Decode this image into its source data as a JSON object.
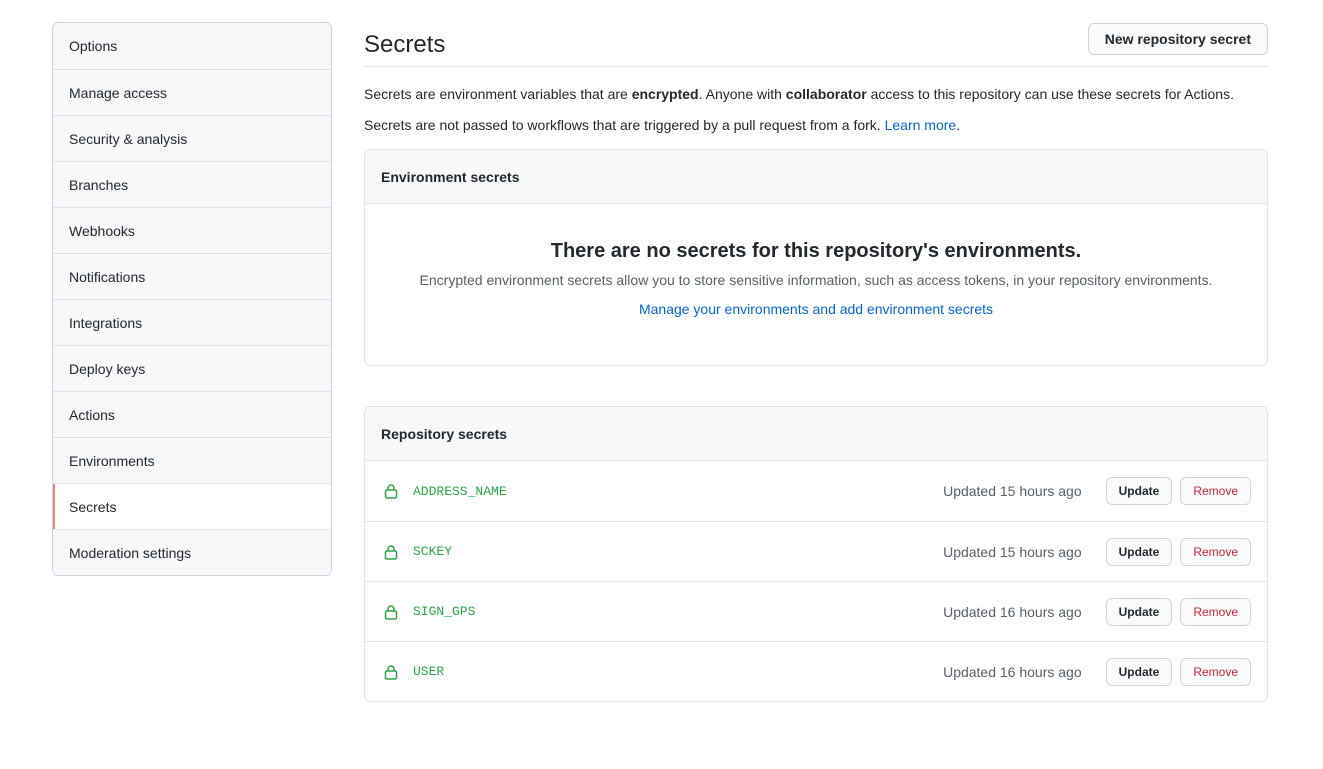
{
  "sidebar": {
    "items": [
      {
        "label": "Options"
      },
      {
        "label": "Manage access"
      },
      {
        "label": "Security & analysis"
      },
      {
        "label": "Branches"
      },
      {
        "label": "Webhooks"
      },
      {
        "label": "Notifications"
      },
      {
        "label": "Integrations"
      },
      {
        "label": "Deploy keys"
      },
      {
        "label": "Actions"
      },
      {
        "label": "Environments"
      },
      {
        "label": "Secrets",
        "selected": true
      },
      {
        "label": "Moderation settings"
      }
    ]
  },
  "header": {
    "title": "Secrets",
    "new_button": "New repository secret"
  },
  "description": {
    "line1_a": "Secrets are environment variables that are ",
    "line1_b": "encrypted",
    "line1_c": ". Anyone with ",
    "line1_d": "collaborator",
    "line1_e": " access to this repository can use these secrets for Actions.",
    "line2_a": "Secrets are not passed to workflows that are triggered by a pull request from a fork. ",
    "line2_link": "Learn more",
    "line2_end": "."
  },
  "environment_secrets": {
    "title": "Environment secrets",
    "empty_title": "There are no secrets for this repository's environments.",
    "empty_text": "Encrypted environment secrets allow you to store sensitive information, such as access tokens, in your repository environments.",
    "empty_link": "Manage your environments and add environment secrets"
  },
  "repository_secrets": {
    "title": "Repository secrets",
    "update_label": "Update",
    "remove_label": "Remove",
    "items": [
      {
        "name": "ADDRESS_NAME",
        "updated": "Updated 15 hours ago"
      },
      {
        "name": "SCKEY",
        "updated": "Updated 15 hours ago"
      },
      {
        "name": "SIGN_GPS",
        "updated": "Updated 16 hours ago"
      },
      {
        "name": "USER",
        "updated": "Updated 16 hours ago"
      }
    ]
  },
  "colors": {
    "accent": "#f9826c",
    "link": "#0366d6",
    "secret_green": "#28a745",
    "danger": "#cb2431"
  },
  "icons": {
    "secret_row": "lock-icon"
  }
}
